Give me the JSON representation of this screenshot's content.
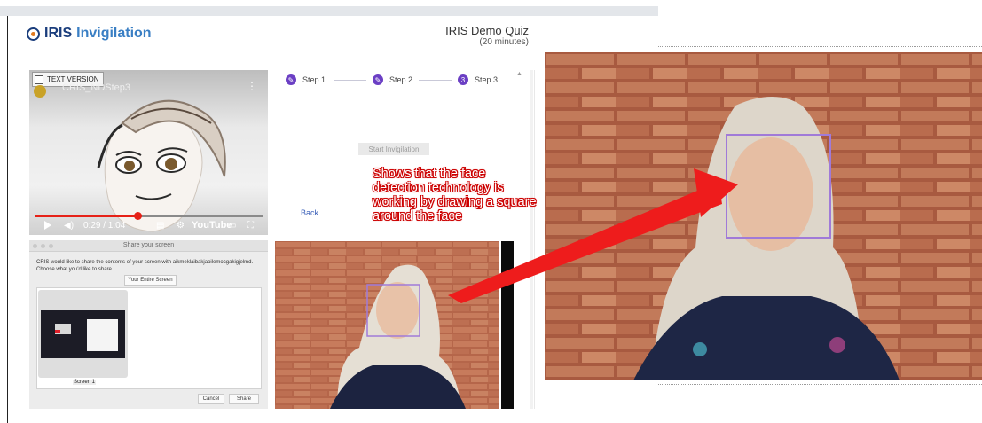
{
  "header": {
    "logo_text_1": "IRIS",
    "logo_text_2": "Invigilation",
    "quiz_title": "IRIS Demo Quiz",
    "quiz_duration": "(20 minutes)"
  },
  "video": {
    "text_version_label": "TEXT VERSION",
    "title": "CRIS_NDStep3",
    "time": "0:29 / 1:04",
    "progress": 0.45,
    "youtube_label": "YouTube"
  },
  "steps": [
    {
      "label": "Step 1",
      "marker": "✎",
      "state": "done"
    },
    {
      "label": "Step 2",
      "marker": "✎",
      "state": "done"
    },
    {
      "label": "Step 3",
      "marker": "3",
      "state": "current"
    }
  ],
  "start_button": "Start Invigilation",
  "back_link": "Back",
  "share_dialog": {
    "title": "Share your screen",
    "message": "CRIS would like to share the contents of your screen with aikmeklaibakjaoilemocgakigjelmd. Choose what you'd like to share.",
    "entire_screen_button": "Your Entire Screen",
    "screen_label": "Screen 1",
    "cancel": "Cancel",
    "share": "Share"
  },
  "annotation": {
    "text": "Shows that the face detection technology is working by drawing a square around the face",
    "color": "#ee1c1c"
  },
  "colors": {
    "accent_purple": "#6b3fc4",
    "face_box": "#a07ad8",
    "brand_blue": "#1a3d7c"
  }
}
